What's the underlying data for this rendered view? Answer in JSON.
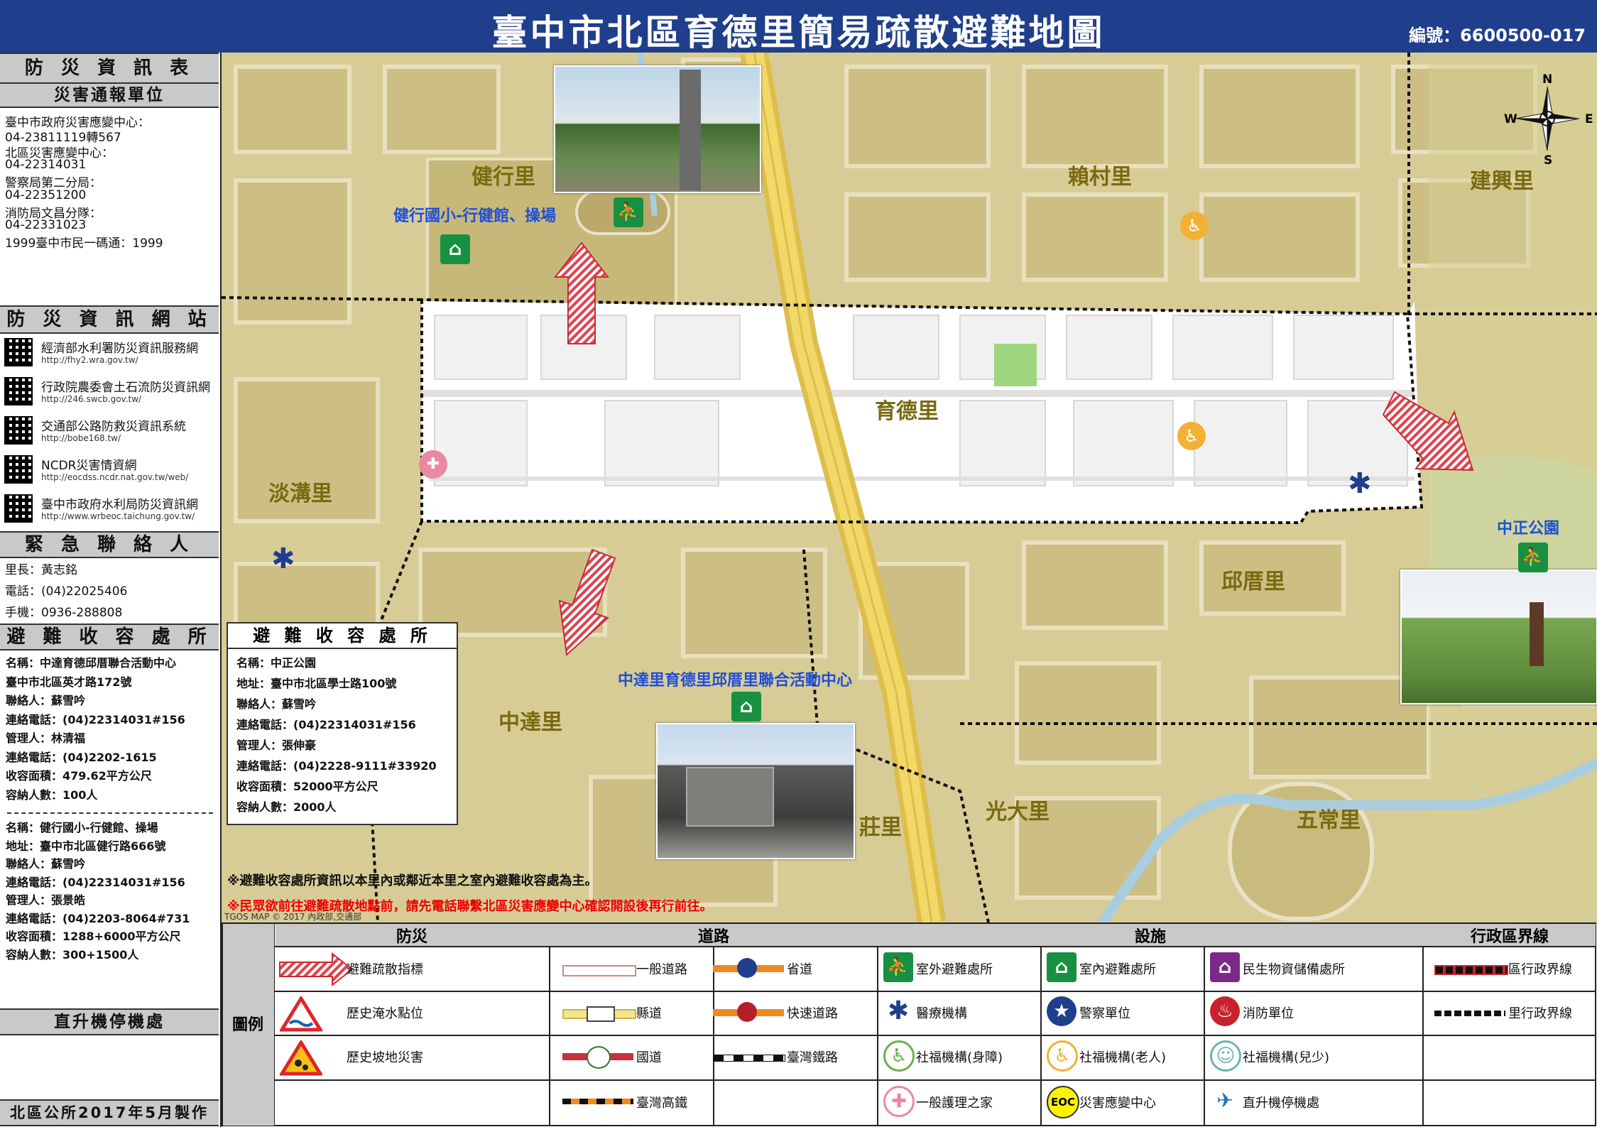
{
  "header": {
    "title": "臺中市北區育德里簡易疏散避難地圖",
    "code": "編號：6600500-017"
  },
  "left": {
    "info_title": "防 災 資 訊 表",
    "report_title": "災害通報單位",
    "report_lines": [
      "臺中市政府災害應變中心：",
      "04-23811119轉567",
      "北區災害應變中心：",
      "04-22314031",
      "警察局第二分局：",
      "04-22351200",
      "消防局文昌分隊：",
      "04-22331023",
      "1999臺中市民一碼通：1999"
    ],
    "web_title": "防 災 資 訊 網 站",
    "websites": [
      {
        "name": "經濟部水利署防災資訊服務網",
        "url": "http://fhy2.wra.gov.tw/"
      },
      {
        "name": "行政院農委會土石流防災資訊網",
        "url": "http://246.swcb.gov.tw/"
      },
      {
        "name": "交通部公路防救災資訊系統",
        "url": "http://bobe168.tw/"
      },
      {
        "name": "NCDR災害情資網",
        "url": "http://eocdss.ncdr.nat.gov.tw/web/"
      },
      {
        "name": "臺中市政府水利局防災資訊網",
        "url": "http://www.wrbeoc.taichung.gov.tw/"
      }
    ],
    "contact_title": "緊 急 聯 絡 人",
    "contact_lines": [
      "里長：黃志銘",
      "電話：(04)22025406",
      "手機：0936-288808"
    ],
    "shelter_title": "避 難 收 容 處 所",
    "shelter1": [
      "名稱：中達育德邱厝聯合活動中心",
      "臺中市北區英才路172號",
      "聯絡人：蘇雪吟",
      "連絡電話：(04)22314031#156",
      "管理人：林清福",
      "連絡電話：(04)2202-1615",
      "收容面積：479.62平方公尺",
      "容納人數：100人"
    ],
    "shelter2": [
      "名稱：健行國小-行健館、操場",
      "地址：臺中市北區健行路666號",
      "聯絡人：蘇雪吟",
      "連絡電話：(04)22314031#156",
      "管理人：張景皓",
      "連絡電話：(04)2203-8064#731",
      "收容面積：1288+6000平方公尺",
      "容納人數：300+1500人"
    ],
    "heli_title": "直升機停機處",
    "footer": "北區公所2017年5月製作"
  },
  "map": {
    "places": {
      "jianxing": "健行里",
      "laicun": "賴村里",
      "jianxing2": "建興里",
      "yude": "育德里",
      "tangou": "淡溝里",
      "qiucuo": "邱厝里",
      "zhongda": "中達里",
      "wuchang": "五常里",
      "guangda": "光大里",
      "zhuang": "莊里"
    },
    "labels": {
      "school_shelter": "健行國小-行健館、操場",
      "park": "中正公園",
      "center": "中達里育德里邱厝里聯合活動中心"
    },
    "compass": {
      "n": "N",
      "s": "S",
      "e": "E",
      "w": "W"
    },
    "shelter_box": {
      "title": "避 難 收 容 處 所",
      "lines": [
        "名稱：中正公園",
        "地址：臺中市北區學士路100號",
        "聯絡人：蘇雪吟",
        "連絡電話：(04)22314031#156",
        "管理人：張伸豪",
        "連絡電話：(04)2228-9111#33920",
        "收容面積：52000平方公尺",
        "容納人數：2000人"
      ]
    },
    "note1": "※避難收容處所資訊以本里內或鄰近本里之室內避難收容處為主。",
    "note2": "※民眾欲前往避難疏散地點前，請先電話聯繫北區災害應變中心確認開設後再行前往。",
    "copyright": "TGOS MAP © 2017 內政部,交通部"
  },
  "legend": {
    "label": "圖例",
    "col_disaster": "防災",
    "col_road": "道路",
    "col_facility": "設施",
    "col_admin": "行政區界線",
    "items": {
      "evac": "避難疏散指標",
      "flood": "歷史淹水點位",
      "slope": "歷史坡地災害",
      "road_general": "一般道路",
      "road_county": "縣道",
      "road_national": "國道",
      "road_hsr": "臺灣高鐵",
      "road_provincial": "省道",
      "road_express": "快速道路",
      "road_rail": "臺灣鐵路",
      "outdoor": "室外避難處所",
      "indoor": "室內避難處所",
      "supply": "民生物資儲備處所",
      "medical": "醫療機構",
      "police": "警察單位",
      "fire": "消防單位",
      "welfare_disabled": "社福機構(身障)",
      "welfare_elder": "社福機構(老人)",
      "welfare_child": "社福機構(兒少)",
      "nursing": "一般護理之家",
      "eoc": "災害應變中心",
      "heli": "直升機停機處",
      "eoc_badge": "EOC",
      "district_line": "區行政界線",
      "village_line": "里行政界線"
    }
  }
}
